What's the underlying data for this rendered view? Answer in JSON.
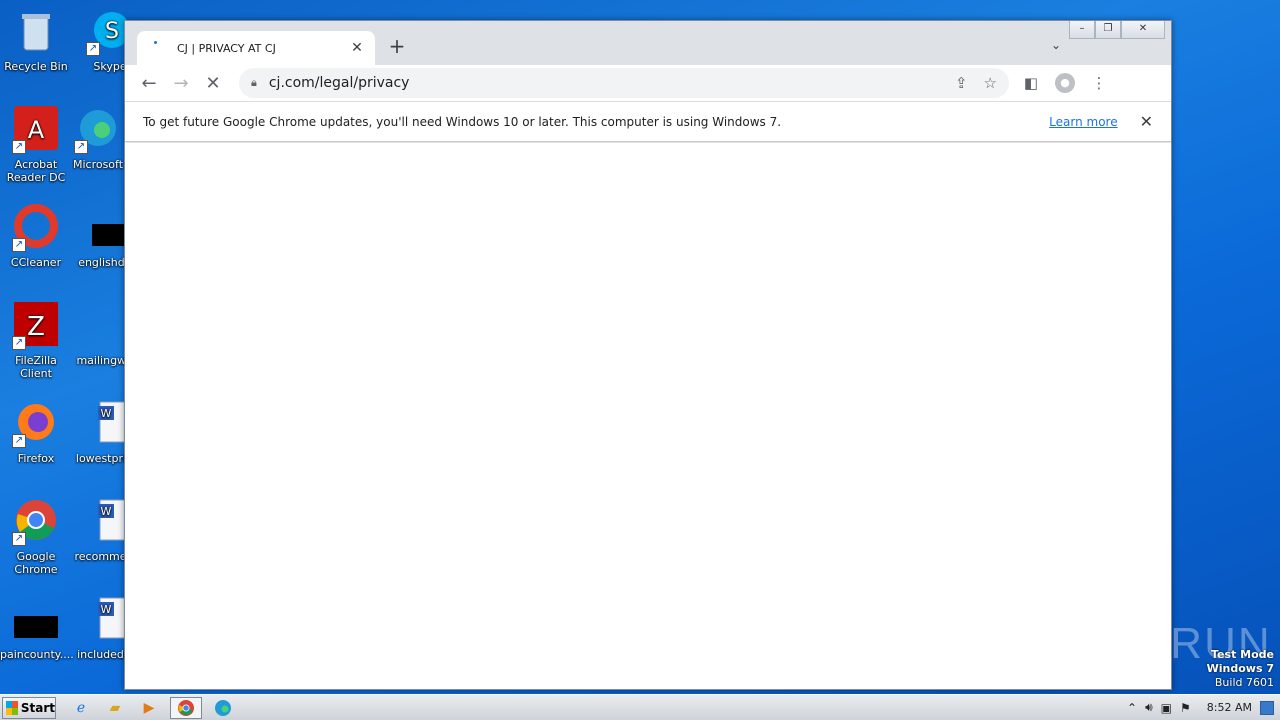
{
  "desktop": {
    "icons": [
      {
        "label": "Recycle Bin",
        "icon": "recycle-bin-icon"
      },
      {
        "label": "Skype",
        "icon": "skype-icon"
      },
      {
        "label": "Acrobat Reader DC",
        "icon": "acrobat-icon"
      },
      {
        "label": "Microsoft",
        "icon": "edge-icon"
      },
      {
        "label": "CCleaner",
        "icon": "ccleaner-icon"
      },
      {
        "label": "englishdic",
        "icon": "blank-file-icon"
      },
      {
        "label": "FileZilla Client",
        "icon": "filezilla-icon"
      },
      {
        "label": "mailingw...",
        "icon": "blank-file-icon"
      },
      {
        "label": "Firefox",
        "icon": "firefox-icon"
      },
      {
        "label": "lowestpric",
        "icon": "word-doc-icon"
      },
      {
        "label": "Google Chrome",
        "icon": "chrome-icon"
      },
      {
        "label": "recommen",
        "icon": "word-doc-icon"
      },
      {
        "label": "paincounty....",
        "icon": "blank-file-icon"
      },
      {
        "label": "includedg",
        "icon": "word-doc-icon"
      }
    ]
  },
  "browser": {
    "tab_title": "CJ | PRIVACY AT CJ",
    "tab_close": "✕",
    "new_tab": "+",
    "url": "cj.com/legal/privacy",
    "infobar": {
      "message": "To get future Google Chrome updates, you'll need Windows 10 or later. This computer is using Windows 7.",
      "learn_more": "Learn more",
      "close": "✕"
    }
  },
  "watermark": "ANY▷RUN",
  "test_mode": {
    "line1": "Test Mode",
    "line2": "Windows 7",
    "line3": "Build 7601"
  },
  "taskbar": {
    "start_label": "Start",
    "clock": "8:52 AM"
  }
}
